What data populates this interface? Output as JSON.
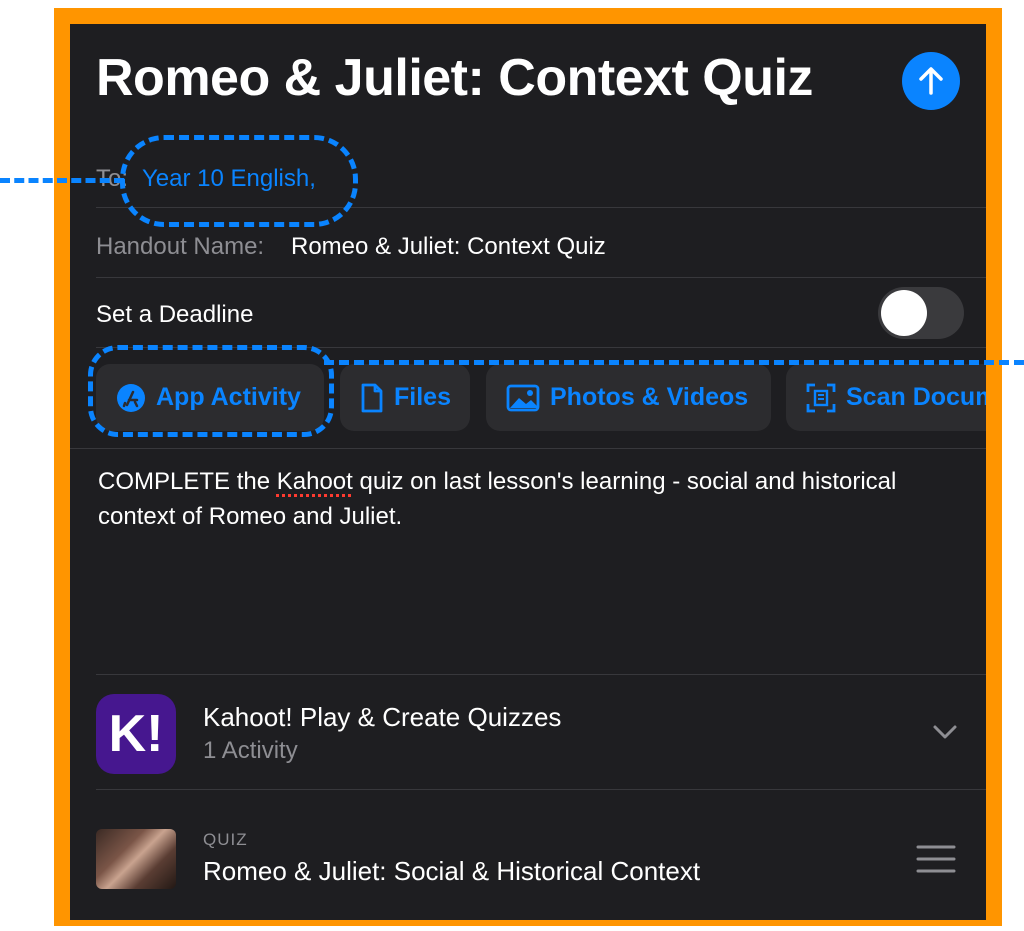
{
  "header": {
    "title": "Romeo & Juliet: Context Quiz",
    "send_icon": "arrow-up-icon"
  },
  "to": {
    "label": "To:",
    "value": "Year 10 English,"
  },
  "handout": {
    "label": "Handout Name:",
    "value": "Romeo & Juliet: Context Quiz"
  },
  "deadline": {
    "label": "Set a Deadline",
    "enabled": false
  },
  "attachments": [
    {
      "label": "App Activity",
      "icon": "app-store-icon"
    },
    {
      "label": "Files",
      "icon": "document-icon"
    },
    {
      "label": "Photos & Videos",
      "icon": "photo-icon"
    },
    {
      "label": "Scan Docum",
      "icon": "scan-document-icon"
    }
  ],
  "instructions": {
    "before": "COMPLETE the ",
    "misspelled": "Kahoot",
    "after": " quiz on last lesson's learning - social and historical context of Romeo and Juliet."
  },
  "app": {
    "name": "Kahoot! Play & Create Quizzes",
    "count": "1 Activity",
    "logo_text": "K!"
  },
  "activity": {
    "type": "QUIZ",
    "title": "Romeo & Juliet: Social & Historical Context"
  },
  "colors": {
    "accent": "#0a84ff",
    "frame": "#ff9500",
    "background": "#1e1e21",
    "kahoot": "#46178f"
  }
}
